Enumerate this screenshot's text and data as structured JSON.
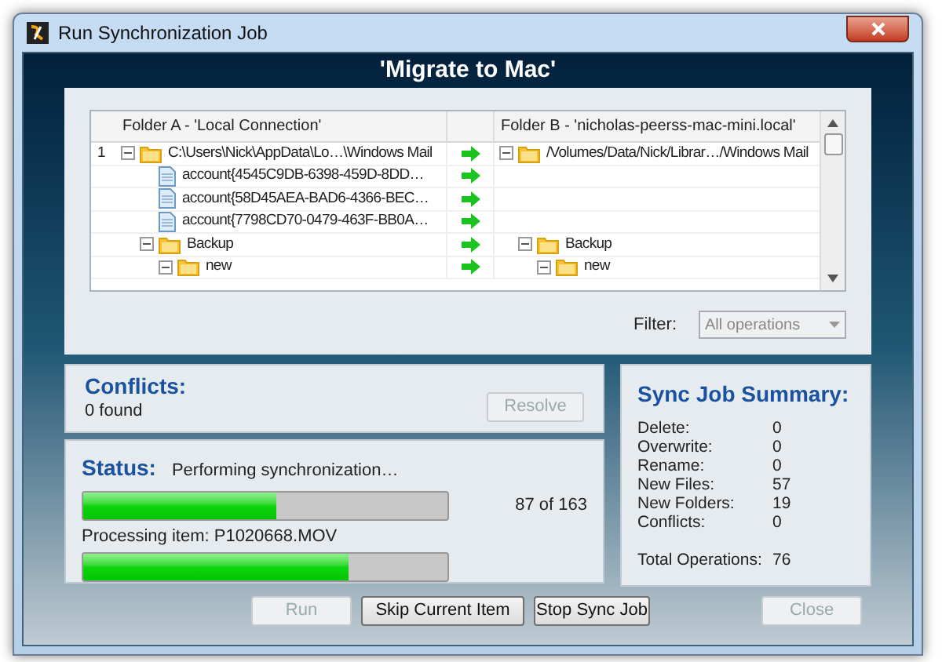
{
  "window": {
    "title": "Run Synchronization Job"
  },
  "job_title": "'Migrate to Mac'",
  "grid": {
    "columns": [
      "Folder A - 'Local Connection'",
      "Folder B - 'nicholas-peerss-mac-mini.local'"
    ],
    "rows": [
      {
        "number": "1",
        "kind": "folder",
        "expanded": true,
        "left": "C:\\Users\\Nick\\AppData\\Lo…\\Windows Mail",
        "right": "/Volumes/Data/Nick/Librar…/Windows Mail",
        "children": [
          {
            "kind": "file",
            "left": "account{4545C9DB-6398-459D-8DD…"
          },
          {
            "kind": "file",
            "left": "account{58D45AEA-BAD6-4366-BEC…"
          },
          {
            "kind": "file",
            "left": "account{7798CD70-0479-463F-BB0A…"
          },
          {
            "kind": "folder",
            "expanded": true,
            "left": "Backup",
            "right": "Backup",
            "children": [
              {
                "kind": "folder",
                "expanded": true,
                "left": "new",
                "right": "new"
              }
            ]
          }
        ]
      }
    ]
  },
  "filter": {
    "label": "Filter:",
    "value": "All operations",
    "disabled": true
  },
  "conflicts": {
    "title": "Conflicts:",
    "count": "0 found",
    "button": {
      "label": "Resolve",
      "disabled": true
    }
  },
  "status": {
    "title": "Status:",
    "message": "Performing synchronization…",
    "overall": {
      "level": 0.53,
      "reading": "87 of 163"
    },
    "item_label": "Processing item: P1020668.MOV",
    "item": {
      "level": 0.73
    }
  },
  "summary": {
    "title": "Sync Job Summary:",
    "items": [
      {
        "label": "Delete:",
        "value": "0"
      },
      {
        "label": "Overwrite:",
        "value": "0"
      },
      {
        "label": "Rename:",
        "value": "0"
      },
      {
        "label": "New Files:",
        "value": "57"
      },
      {
        "label": "New Folders:",
        "value": "19"
      },
      {
        "label": "Conflicts:",
        "value": "0"
      }
    ],
    "total": {
      "label": "Total Operations:",
      "value": "76"
    }
  },
  "buttons": [
    {
      "label": "Run",
      "disabled": true
    },
    {
      "label": "Skip Current Item",
      "disabled": false
    },
    {
      "label": "Stop Sync Job",
      "disabled": false
    }
  ],
  "close_button": {
    "label": "Close",
    "disabled": true
  }
}
